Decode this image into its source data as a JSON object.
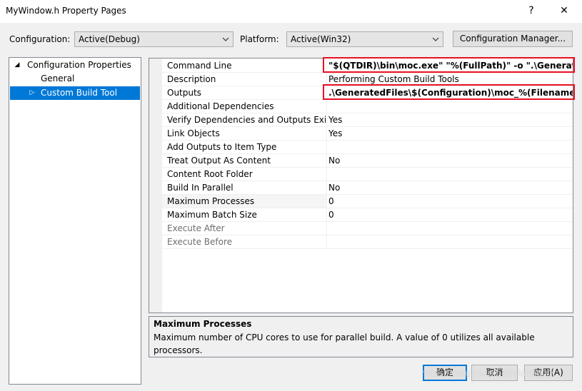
{
  "window": {
    "title": "MyWindow.h Property Pages",
    "help_glyph": "?",
    "close_glyph": "✕"
  },
  "toolbar": {
    "configuration_label": "Configuration:",
    "configuration_value": "Active(Debug)",
    "platform_label": "Platform:",
    "platform_value": "Active(Win32)",
    "config_manager_label": "Configuration Manager..."
  },
  "tree": {
    "root": "Configuration Properties",
    "items": [
      "General",
      "Custom Build Tool"
    ],
    "selected": "Custom Build Tool"
  },
  "grid": {
    "rows": [
      {
        "name": "Command Line",
        "value": "\"$(QTDIR)\\bin\\moc.exe\" \"%(FullPath)\" -o \".\\GeneratedF",
        "bold": true
      },
      {
        "name": "Description",
        "value": "Performing Custom Build Tools"
      },
      {
        "name": "Outputs",
        "value": ".\\GeneratedFiles\\$(Configuration)\\moc_%(Filename).cpp",
        "bold": true
      },
      {
        "name": "Additional Dependencies",
        "value": ""
      },
      {
        "name": "Verify Dependencies and Outputs Exis",
        "value": "Yes"
      },
      {
        "name": "Link Objects",
        "value": "Yes"
      },
      {
        "name": "Add Outputs to Item Type",
        "value": ""
      },
      {
        "name": "Treat Output As Content",
        "value": "No"
      },
      {
        "name": "Content Root Folder",
        "value": ""
      },
      {
        "name": "Build In Parallel",
        "value": "No"
      },
      {
        "name": "Maximum Processes",
        "value": "0"
      },
      {
        "name": "Maximum Batch Size",
        "value": "0"
      },
      {
        "name": "Execute After",
        "value": "",
        "disabled": true
      },
      {
        "name": "Execute Before",
        "value": "",
        "disabled": true
      }
    ]
  },
  "description": {
    "title": "Maximum Processes",
    "text": "Maximum number of CPU cores to use for parallel build. A value of 0 utilizes all available processors."
  },
  "buttons": {
    "ok": "确定",
    "cancel": "取消",
    "apply": "应用(A)"
  },
  "watermark": "https://blog.csdn.net/xiao6g00",
  "colors": {
    "selection": "#0078d7",
    "highlight_box": "#e81123",
    "dialog_bg": "#f0f0f0"
  }
}
